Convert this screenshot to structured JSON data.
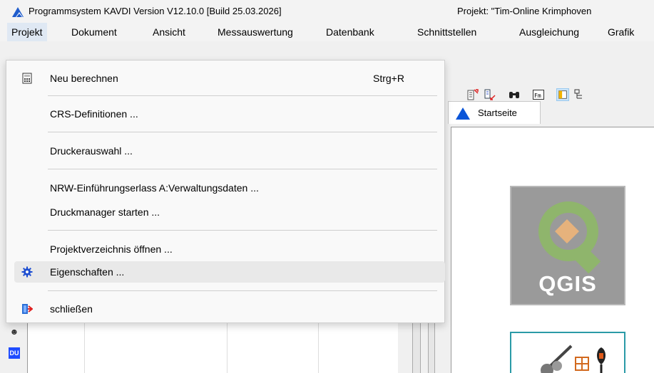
{
  "window": {
    "title": "Programmsystem KAVDI Version V12.10.0 [Build 25.03.2026]",
    "project": "Projekt: \"Tim-Online Krimphoven"
  },
  "menubar": {
    "items": [
      "Projekt",
      "Dokument",
      "Ansicht",
      "Messauswertung",
      "Datenbank",
      "Schnittstellen",
      "Ausgleichung",
      "Grafik"
    ]
  },
  "project_menu": {
    "recalc": {
      "label": "Neu berechnen",
      "shortcut": "Strg+R"
    },
    "crs": "CRS-Definitionen ...",
    "printer": "Druckerauswahl ...",
    "nrw": "NRW-Einführungserlass A:Verwaltungsdaten ...",
    "print_manager": "Druckmanager starten ...",
    "open_dir": "Projektverzeichnis öffnen ...",
    "properties": "Eigenschaften ...",
    "close": "schließen"
  },
  "tab": {
    "label": "Startseite"
  },
  "qgis_tile": {
    "label": "QGIS"
  },
  "left_toolbar": {
    "du_label": "DU"
  },
  "colors": {
    "accent": "#0a55d8",
    "qgis_green": "#8fb56c",
    "survey_border": "#2a9aa7"
  },
  "icons": {
    "app": "kavdi-logo-icon",
    "recalc": "calculator-icon",
    "properties": "gear-icon",
    "close": "exit-door-icon",
    "tab": "triangle-icon"
  }
}
